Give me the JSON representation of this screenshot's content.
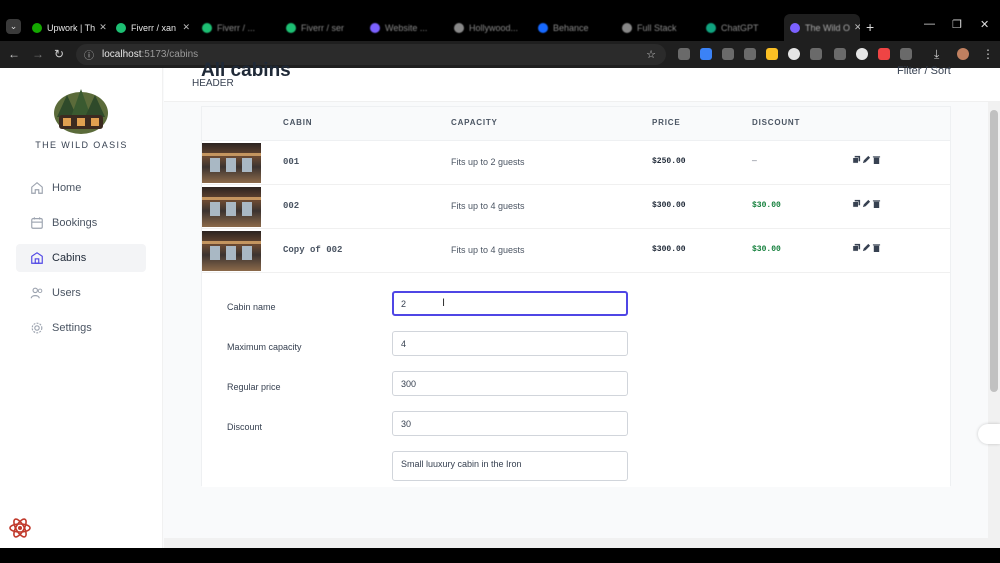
{
  "browser": {
    "tabs": [
      {
        "label": "Upwork | Th",
        "color": "#14a800"
      },
      {
        "label": "Fiverr / xan",
        "color": "#1dbf73"
      },
      {
        "label": "Fiverr / ...",
        "color": "#1dbf73"
      },
      {
        "label": "Fiverr / ser",
        "color": "#1dbf73"
      },
      {
        "label": "Website ...",
        "color": "#7b61ff"
      },
      {
        "label": "Hollywood...",
        "color": "#888888"
      },
      {
        "label": "Behance",
        "color": "#1769ff"
      },
      {
        "label": "Full Stack",
        "color": "#888888"
      },
      {
        "label": "ChatGPT",
        "color": "#10a37f"
      },
      {
        "label": "The Wild O",
        "color": "#7b61ff"
      }
    ],
    "url_host": "localhost",
    "url_path": ":5173/cabins"
  },
  "sidebar": {
    "brand": "THE WILD OASIS",
    "items": [
      {
        "label": "Home",
        "icon": "home-icon"
      },
      {
        "label": "Bookings",
        "icon": "calendar-icon"
      },
      {
        "label": "Cabins",
        "icon": "cabins-icon"
      },
      {
        "label": "Users",
        "icon": "users-icon"
      },
      {
        "label": "Settings",
        "icon": "settings-icon"
      }
    ],
    "active": "Cabins",
    "accent": "#4f46e5"
  },
  "header": {
    "label": "HEADER"
  },
  "main": {
    "title": "All cabins",
    "filter_sort": "Filter / Sort"
  },
  "table": {
    "columns": [
      "CABIN",
      "CAPACITY",
      "PRICE",
      "DISCOUNT"
    ],
    "rows": [
      {
        "name": "001",
        "capacity": "Fits up to 2 guests",
        "price": "$250.00",
        "discount": "—"
      },
      {
        "name": "002",
        "capacity": "Fits up to 4 guests",
        "price": "$300.00",
        "discount": "$30.00"
      },
      {
        "name": "Copy of 002",
        "capacity": "Fits up to 4 guests",
        "price": "$300.00",
        "discount": "$30.00"
      }
    ]
  },
  "form": {
    "fields": [
      {
        "label": "Cabin name",
        "value": "2"
      },
      {
        "label": "Maximum capacity",
        "value": "4"
      },
      {
        "label": "Regular price",
        "value": "300"
      },
      {
        "label": "Discount",
        "value": "30"
      },
      {
        "label": "",
        "value": "Small luuxury cabin in the Iron"
      }
    ]
  },
  "colors": {
    "discount_green": "#15803d",
    "focus_border": "#4f46e5"
  }
}
